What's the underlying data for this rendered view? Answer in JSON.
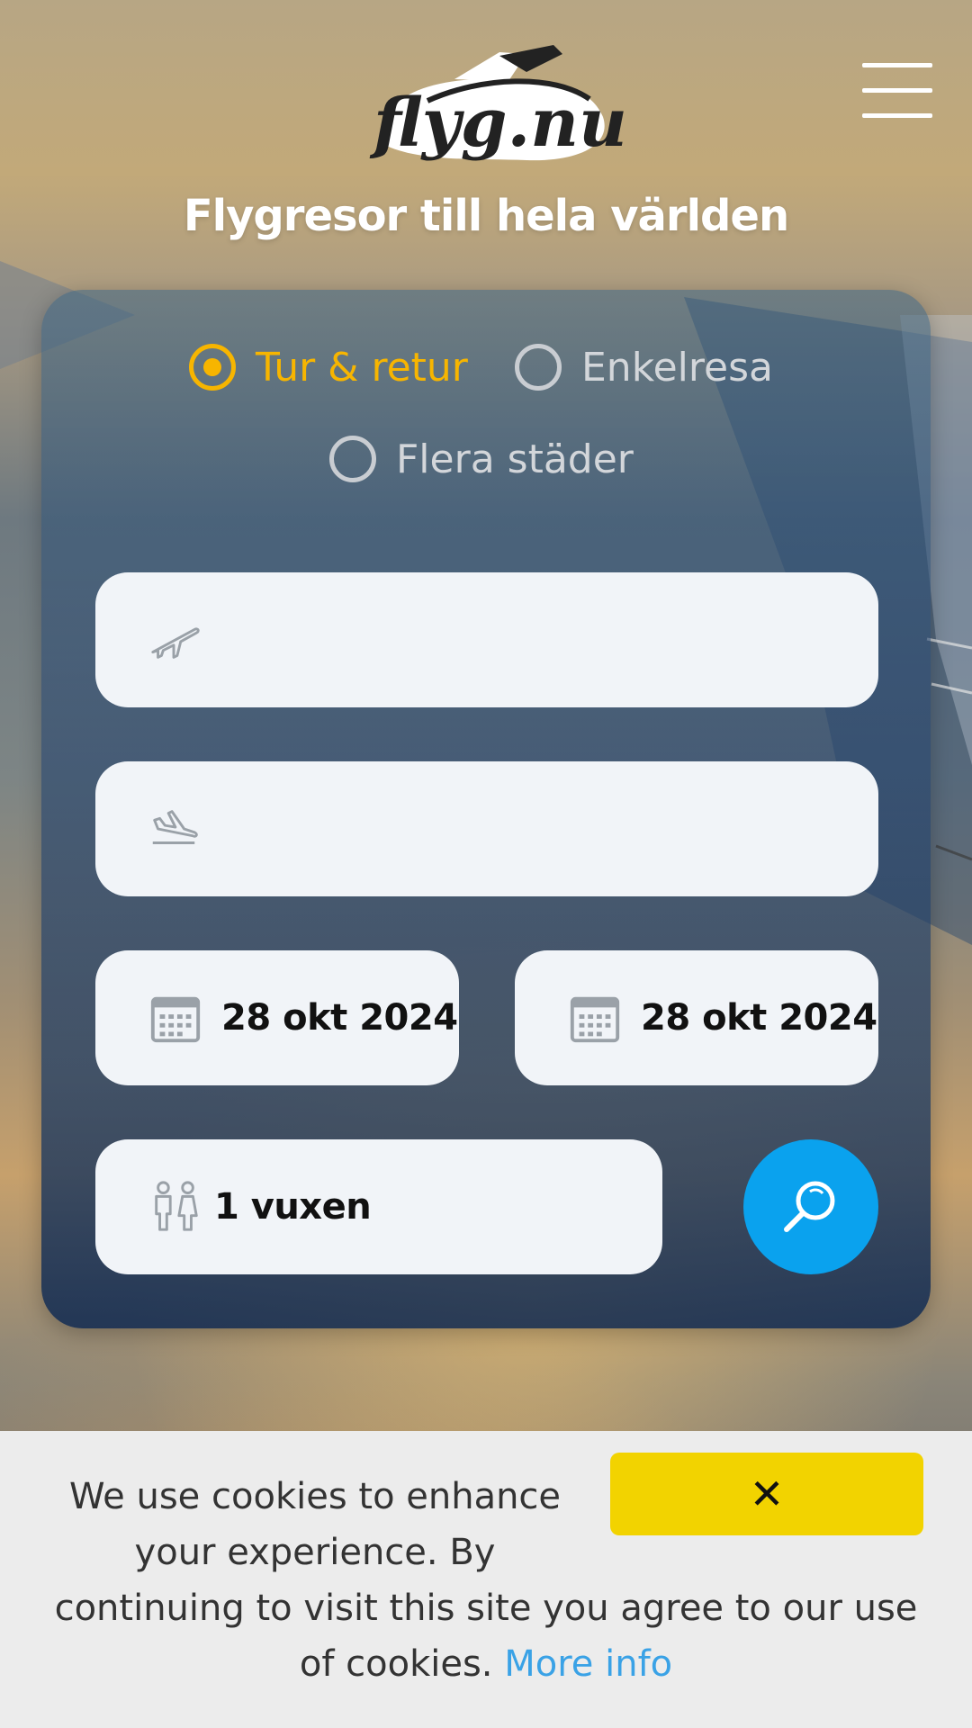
{
  "header": {
    "logo_text": "flyg.nu",
    "menu_icon": "hamburger-menu-icon",
    "tagline": "Flygresor till hela världen"
  },
  "search": {
    "trip_types": [
      {
        "label": "Tur & retur",
        "selected": true
      },
      {
        "label": "Enkelresa",
        "selected": false
      },
      {
        "label": "Flera städer",
        "selected": false
      }
    ],
    "from": {
      "value": "",
      "icon": "plane-departure-icon"
    },
    "to": {
      "value": "",
      "icon": "plane-arrival-icon"
    },
    "depart_date": {
      "value": "28 okt 2024",
      "icon": "calendar-icon"
    },
    "return_date": {
      "value": "28 okt 2024",
      "icon": "calendar-icon"
    },
    "passengers": {
      "value": "1 vuxen",
      "icon": "passengers-icon"
    },
    "search_icon": "search-icon"
  },
  "cookie_banner": {
    "text_line1": "We use cookies to enhance your experience. By",
    "text_line2": "continuing to visit this site you agree to our use of cookies.",
    "more_info": "More info",
    "close_label": "✕"
  },
  "colors": {
    "accent": "#f7b500",
    "search_button": "#0aa2ee",
    "cookie_close": "#f2d300",
    "link": "#3aa2e6"
  }
}
